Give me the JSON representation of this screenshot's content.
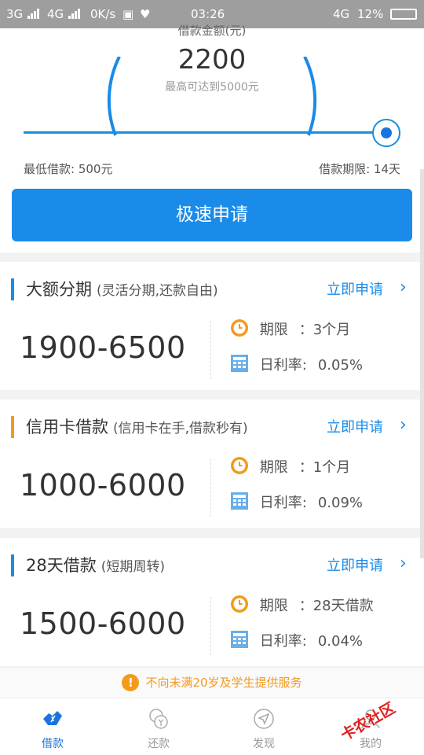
{
  "status_bar": {
    "network1": "3G",
    "network2": "4G",
    "speed": "0K/s",
    "time": "03:26",
    "network3": "4G",
    "battery": "12%"
  },
  "loan": {
    "amount_label": "借款金额(元)",
    "amount_value": "2200",
    "max_text": "最高可达到5000元",
    "slider_level_percent": 100,
    "min_text": "最低借款: 500元",
    "term_text": "借款期限: 14天",
    "apply_button": "极速申请"
  },
  "products": [
    {
      "title": "大额分期",
      "subtitle": "(灵活分期,还款自由)",
      "link": "立即申请",
      "range": "1900-6500",
      "term_label": "期限",
      "term_sep": "：",
      "term_value": "3个月",
      "rate_label": "日利率:",
      "rate_value": "0.05%",
      "accent": "#1a8be8"
    },
    {
      "title": "信用卡借款",
      "subtitle": "(信用卡在手,借款秒有)",
      "link": "立即申请",
      "range": "1000-6000",
      "term_label": "期限",
      "term_sep": "：",
      "term_value": "1个月",
      "rate_label": "日利率:",
      "rate_value": "0.09%",
      "accent": "#f39a1d"
    },
    {
      "title": "28天借款",
      "subtitle": "(短期周转)",
      "link": "立即申请",
      "range": "1500-6000",
      "term_label": "期限",
      "term_sep": "：",
      "term_value": "28天借款",
      "rate_label": "日利率:",
      "rate_value": "0.04%",
      "accent": "#1a8be8"
    }
  ],
  "notice": "不向未满20岁及学生提供服务",
  "tabs": [
    {
      "label": "借款",
      "icon": "loan-icon",
      "active": true
    },
    {
      "label": "还款",
      "icon": "repay-icon",
      "active": false
    },
    {
      "label": "发现",
      "icon": "discover-icon",
      "active": false
    },
    {
      "label": "我的",
      "icon": "profile-icon",
      "active": false
    }
  ],
  "watermark": "卡农社区",
  "colors": {
    "primary": "#1a8be8",
    "orange": "#f39a1d",
    "calendar": "#6aaee8"
  }
}
